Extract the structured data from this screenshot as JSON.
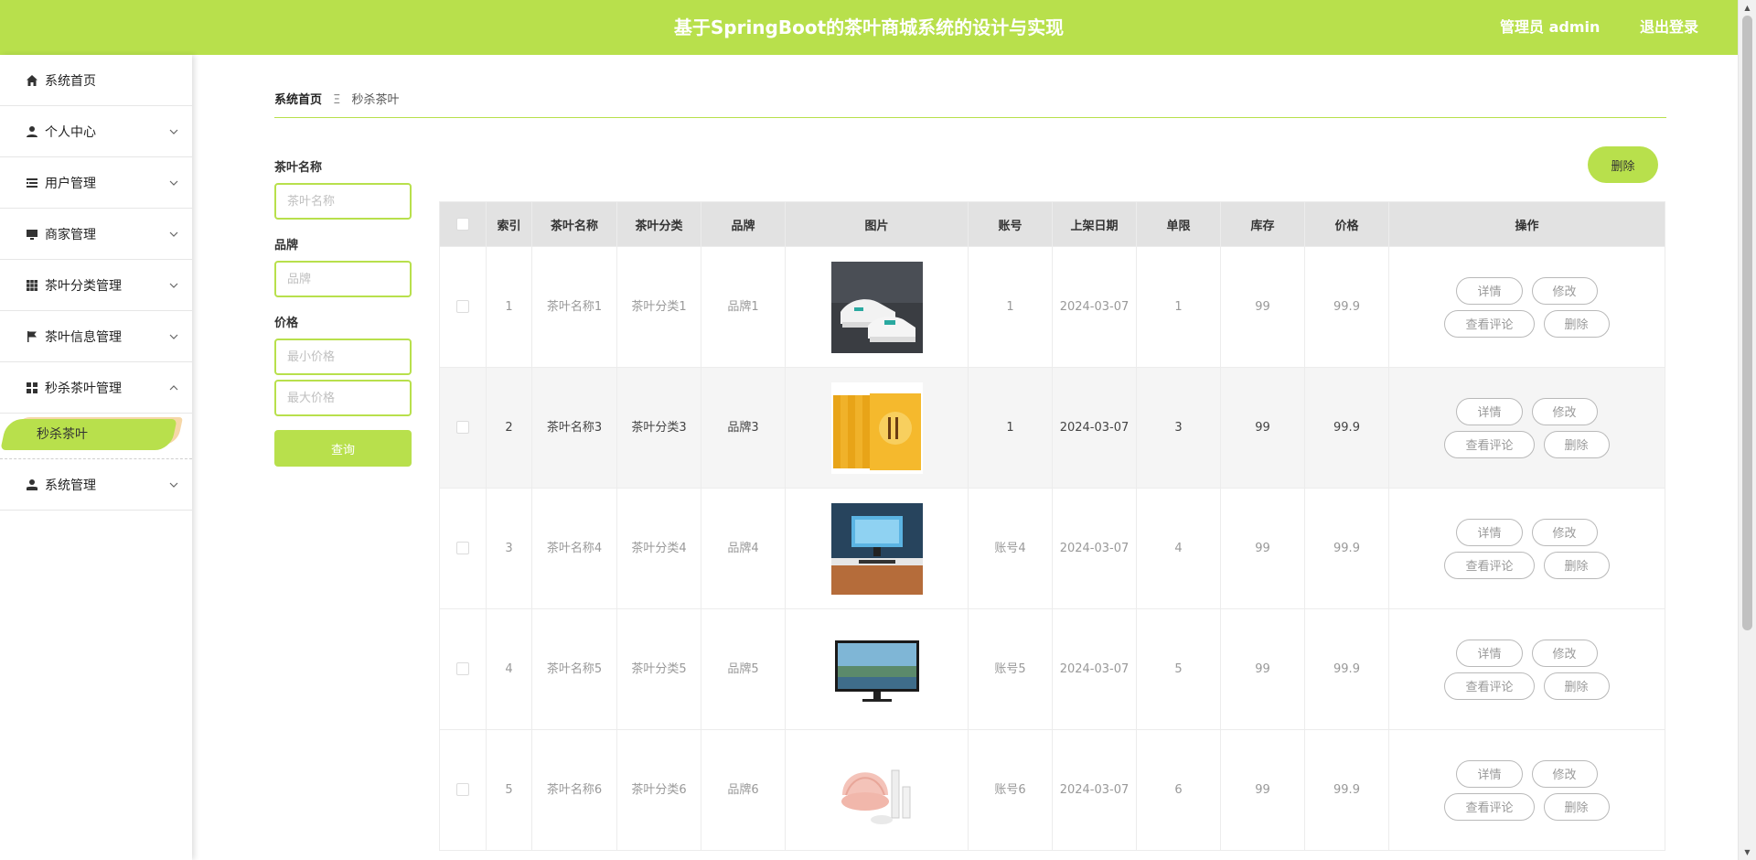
{
  "header": {
    "title": "基于SpringBoot的茶叶商城系统的设计与实现",
    "user": "管理员 admin",
    "logout": "退出登录"
  },
  "sidebar": {
    "items": [
      {
        "label": "系统首页",
        "icon": "home-icon",
        "expandable": false
      },
      {
        "label": "个人中心",
        "icon": "user-icon",
        "expandable": true
      },
      {
        "label": "用户管理",
        "icon": "list-icon",
        "expandable": true
      },
      {
        "label": "商家管理",
        "icon": "monitor-icon",
        "expandable": true
      },
      {
        "label": "茶叶分类管理",
        "icon": "grid-icon",
        "expandable": true
      },
      {
        "label": "茶叶信息管理",
        "icon": "flag-icon",
        "expandable": true
      },
      {
        "label": "秒杀茶叶管理",
        "icon": "apps-icon",
        "expandable": true,
        "expanded": true
      },
      {
        "label": "系统管理",
        "icon": "admin-icon",
        "expandable": true
      }
    ],
    "active_sub": "秒杀茶叶"
  },
  "breadcrumb": {
    "home": "系统首页",
    "separator": "Ξ",
    "current": "秒杀茶叶"
  },
  "filters": {
    "name_label": "茶叶名称",
    "name_placeholder": "茶叶名称",
    "brand_label": "品牌",
    "brand_placeholder": "品牌",
    "price_label": "价格",
    "min_placeholder": "最小价格",
    "max_placeholder": "最大价格",
    "query": "查询"
  },
  "toolbar": {
    "delete": "删除"
  },
  "table": {
    "columns": [
      "索引",
      "茶叶名称",
      "茶叶分类",
      "品牌",
      "图片",
      "账号",
      "上架日期",
      "单限",
      "库存",
      "价格",
      "操作"
    ],
    "rows": [
      {
        "index": "1",
        "name": "茶叶名称1",
        "category": "茶叶分类1",
        "brand": "品牌1",
        "image": "sneakers",
        "account": "1",
        "date": "2024-03-07",
        "limit": "1",
        "stock": "99",
        "price": "99.9"
      },
      {
        "index": "2",
        "name": "茶叶名称3",
        "category": "茶叶分类3",
        "brand": "品牌3",
        "image": "books",
        "account": "1",
        "date": "2024-03-07",
        "limit": "3",
        "stock": "99",
        "price": "99.9"
      },
      {
        "index": "3",
        "name": "茶叶名称4",
        "category": "茶叶分类4",
        "brand": "品牌4",
        "image": "desk-monitor",
        "account": "账号4",
        "date": "2024-03-07",
        "limit": "4",
        "stock": "99",
        "price": "99.9"
      },
      {
        "index": "4",
        "name": "茶叶名称5",
        "category": "茶叶分类5",
        "brand": "品牌5",
        "image": "monitor",
        "account": "账号5",
        "date": "2024-03-07",
        "limit": "5",
        "stock": "99",
        "price": "99.9"
      },
      {
        "index": "5",
        "name": "茶叶名称6",
        "category": "茶叶分类6",
        "brand": "品牌6",
        "image": "cosmetics",
        "account": "账号6",
        "date": "2024-03-07",
        "limit": "6",
        "stock": "99",
        "price": "99.9"
      }
    ],
    "row_actions": {
      "detail": "详情",
      "edit": "修改",
      "reviews": "查看评论",
      "delete": "删除"
    }
  },
  "colors": {
    "accent": "#b8e04c",
    "header_text": "#ffffff",
    "table_header": "#e2e2e2",
    "row_alt": "#f5f5f5"
  }
}
